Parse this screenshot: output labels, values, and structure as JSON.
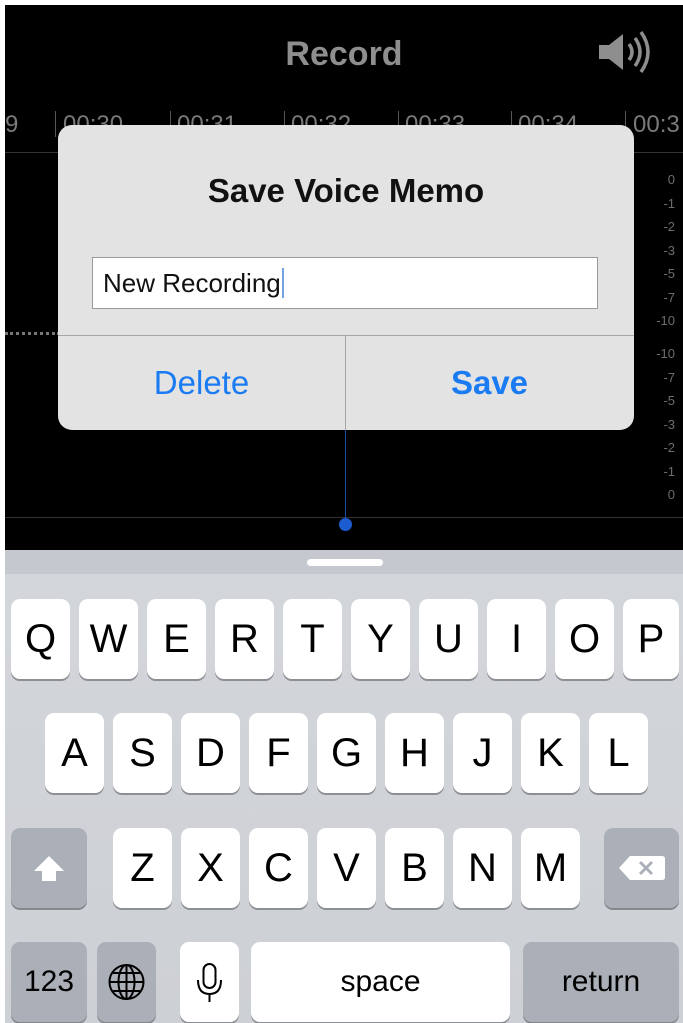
{
  "app": {
    "title": "Record",
    "icons": {
      "speaker": "speaker-volume-icon",
      "delete": "backspace-icon",
      "shift": "shift-arrow-icon",
      "globe": "globe-icon",
      "mic": "microphone-icon"
    }
  },
  "timeline": {
    "labels": [
      "9",
      "00:30",
      "00:31",
      "00:32",
      "00:33",
      "00:34",
      "00:3"
    ],
    "db_upper": [
      "0",
      "-1",
      "-2",
      "-3",
      "-5",
      "-7",
      "-10"
    ],
    "db_lower": [
      "-10",
      "-7",
      "-5",
      "-3",
      "-2",
      "-1",
      "0"
    ]
  },
  "dialog": {
    "title": "Save Voice Memo",
    "input_value": "New Recording",
    "delete_label": "Delete",
    "save_label": "Save"
  },
  "keyboard": {
    "row1": [
      "Q",
      "W",
      "E",
      "R",
      "T",
      "Y",
      "U",
      "I",
      "O",
      "P"
    ],
    "row2": [
      "A",
      "S",
      "D",
      "F",
      "G",
      "H",
      "J",
      "K",
      "L"
    ],
    "row3": [
      "Z",
      "X",
      "C",
      "V",
      "B",
      "N",
      "M"
    ],
    "numbers_label": "123",
    "space_label": "space",
    "return_label": "return"
  },
  "colors": {
    "accent": "#1a7bf2",
    "playhead": "#1c4fa8"
  }
}
